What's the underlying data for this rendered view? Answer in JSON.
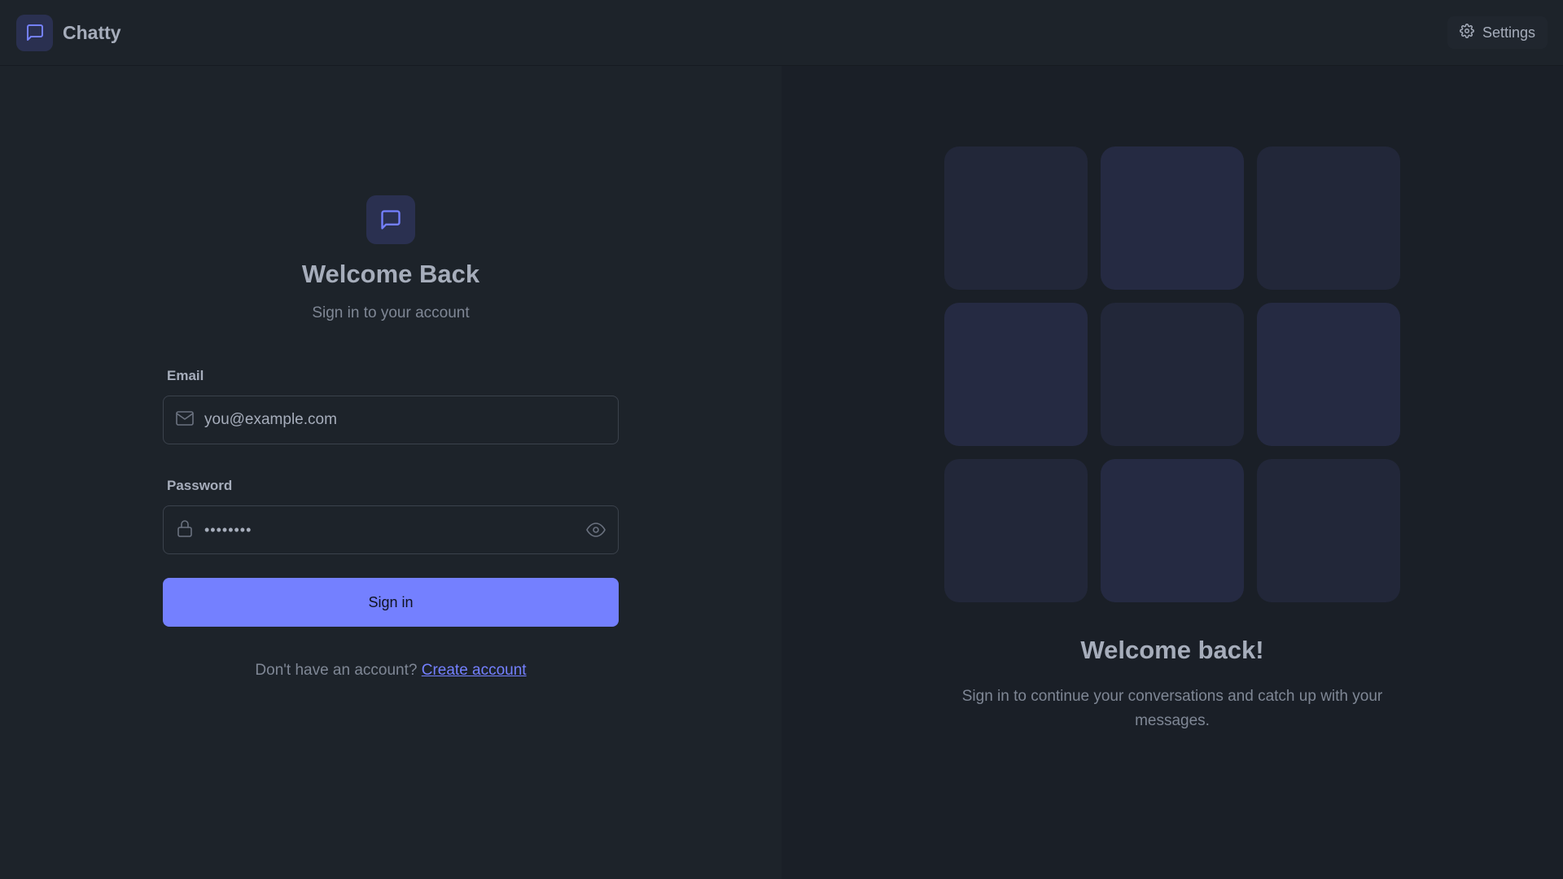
{
  "app": {
    "name": "Chatty"
  },
  "nav": {
    "settings_label": "Settings"
  },
  "login": {
    "title": "Welcome Back",
    "subtitle": "Sign in to your account",
    "email_label": "Email",
    "email_placeholder": "you@example.com",
    "password_label": "Password",
    "password_value": "••••••••",
    "submit_label": "Sign in",
    "signup_prompt": "Don't have an account?",
    "signup_link": "Create account"
  },
  "hero": {
    "title": "Welcome back!",
    "text": "Sign in to continue your conversations and catch up with your messages."
  },
  "icons": {
    "brand": "message-square-icon",
    "settings": "gear-icon",
    "email": "mail-icon",
    "password": "lock-icon",
    "toggle": "eye-icon"
  },
  "colors": {
    "accent": "#7480ff",
    "background": "#1d232a",
    "text": "#a6adbb"
  }
}
